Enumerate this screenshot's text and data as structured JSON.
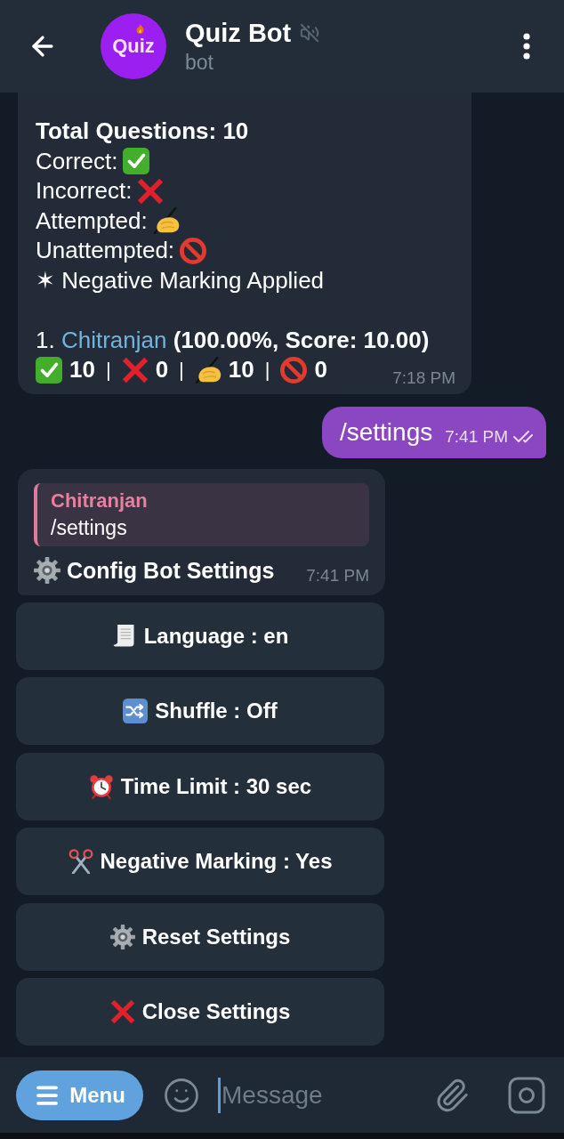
{
  "header": {
    "title": "Quiz Bot",
    "muted": true,
    "subtitle": "bot",
    "avatar_text": "Quiz"
  },
  "messages": [
    {
      "kind": "results",
      "heading": "Total Questions: 10",
      "legend": [
        {
          "kind": "correct",
          "label": "Correct:"
        },
        {
          "kind": "incorrect",
          "label": "Incorrect:"
        },
        {
          "kind": "attempted",
          "label": "Attempted:"
        },
        {
          "kind": "unattempted",
          "label": "Unattempted:"
        }
      ],
      "note": "✶ Negative Marking Applied",
      "ranking": [
        {
          "rank": "1.",
          "name": "Chitranjan",
          "result": "(100.00%, Score: 10.00)",
          "stats": [
            {
              "kind": "correct",
              "count": "10",
              "separator": "|"
            },
            {
              "kind": "incorrect",
              "count": "0",
              "separator": "|"
            },
            {
              "kind": "attempted",
              "count": "10",
              "separator": "|"
            },
            {
              "kind": "unattempted",
              "count": "0"
            }
          ]
        }
      ],
      "time": "7:18 PM"
    },
    {
      "kind": "outgoing",
      "text": "/settings",
      "time": "7:41 PM",
      "read": true
    },
    {
      "kind": "reply",
      "quote": {
        "author": "Chitranjan",
        "text": "/settings"
      },
      "text": "Config Bot Settings",
      "time": "7:41 PM"
    }
  ],
  "keyboard": [
    {
      "kind": "language",
      "label": "Language : en"
    },
    {
      "kind": "shuffle",
      "label": "Shuffle : Off"
    },
    {
      "kind": "time_limit",
      "label": "Time Limit : 30 sec"
    },
    {
      "kind": "negative_marking",
      "label": "Negative Marking : Yes"
    },
    {
      "kind": "reset",
      "label": "Reset Settings"
    },
    {
      "kind": "close",
      "label": "Close Settings"
    }
  ],
  "composer": {
    "menu_label": "Menu",
    "placeholder": "Message"
  }
}
